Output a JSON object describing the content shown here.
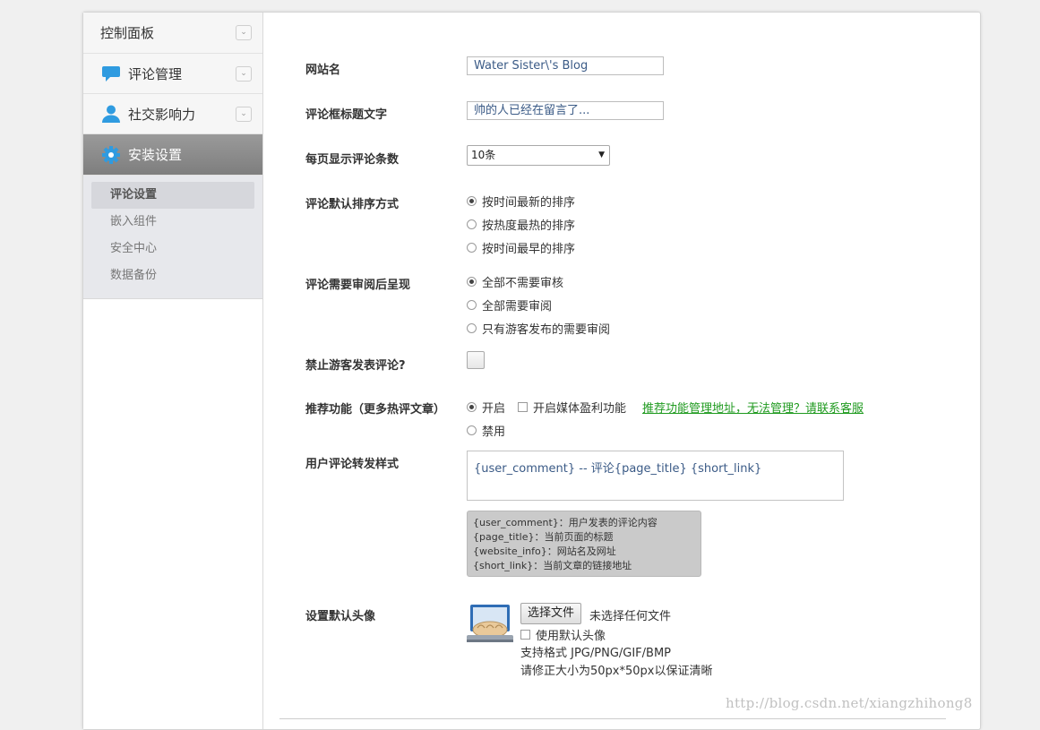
{
  "sidebar": {
    "items": [
      {
        "label": "控制面板",
        "icon": "",
        "active": false
      },
      {
        "label": "评论管理",
        "icon": "chat-bubble-icon",
        "active": false
      },
      {
        "label": "社交影响力",
        "icon": "user-icon",
        "active": false
      },
      {
        "label": "安装设置",
        "icon": "gear-icon",
        "active": true
      }
    ],
    "subitems": [
      "评论设置",
      "嵌入组件",
      "安全中心",
      "数据备份"
    ]
  },
  "form": {
    "site_name": {
      "label": "网站名",
      "value": "Water Sister\\'s Blog"
    },
    "comment_title": {
      "label": "评论框标题文字",
      "value": "帅的人已经在留言了..."
    },
    "per_page": {
      "label": "每页显示评论条数",
      "value": "10条"
    },
    "sort": {
      "label": "评论默认排序方式",
      "options": [
        "按时间最新的排序",
        "按热度最热的排序",
        "按时间最早的排序"
      ],
      "selected": 0
    },
    "review": {
      "label": "评论需要审阅后呈现",
      "options": [
        "全部不需要审核",
        "全部需要审阅",
        "只有游客发布的需要审阅"
      ],
      "selected": 0
    },
    "ban_guest": {
      "label": "禁止游客发表评论?"
    },
    "recommend": {
      "label": "推荐功能（更多热评文章）",
      "on": "开启",
      "off": "禁用",
      "media_label": "开启媒体盈利功能",
      "link": "推荐功能管理地址，无法管理？请联系客服"
    },
    "share_format": {
      "label": "用户评论转发样式",
      "value": "{user_comment} -- 评论{page_title} {short_link}",
      "hints": [
        "{user_comment}：用户发表的评论内容",
        "{page_title}：当前页面的标题",
        "{website_info}：网站名及网址",
        "{short_link}：当前文章的链接地址"
      ]
    },
    "avatar": {
      "label": "设置默认头像",
      "button": "选择文件",
      "no_file": "未选择任何文件",
      "use_default": "使用默认头像",
      "formats": "支持格式 JPG/PNG/GIF/BMP",
      "size_note": "请修正大小为50px*50px以保证清晰"
    }
  },
  "watermark": "http://blog.csdn.net/xiangzhihong8",
  "colors": {
    "accent": "#2f9be0",
    "link": "#1f9a1f",
    "active_nav": "#8c8c8c"
  }
}
